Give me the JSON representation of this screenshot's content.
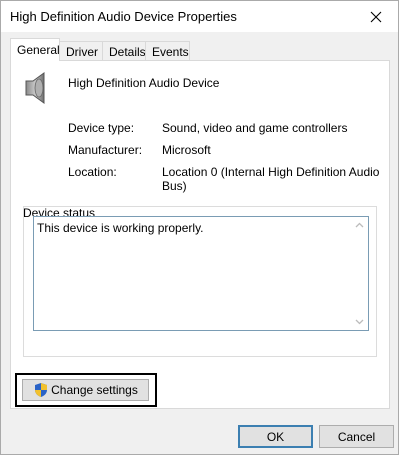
{
  "window": {
    "title": "High Definition Audio Device Properties"
  },
  "tabs": [
    {
      "label": "General",
      "active": true
    },
    {
      "label": "Driver",
      "active": false
    },
    {
      "label": "Details",
      "active": false
    },
    {
      "label": "Events",
      "active": false
    }
  ],
  "device": {
    "icon": "speaker-icon",
    "name": "High Definition Audio Device",
    "properties": [
      {
        "label": "Device type:",
        "value": "Sound, video and game controllers"
      },
      {
        "label": "Manufacturer:",
        "value": "Microsoft"
      },
      {
        "label": "Location:",
        "value": "Location 0 (Internal High Definition Audio Bus)"
      }
    ]
  },
  "status": {
    "legend": "Device status",
    "text": "This device is working properly."
  },
  "actions": {
    "change_settings_label": "Change settings",
    "change_settings_icon": "shield-icon"
  },
  "footer": {
    "ok_label": "OK",
    "cancel_label": "Cancel"
  },
  "colors": {
    "accent": "#3c7fb1",
    "shield_blue": "#2a63c7",
    "shield_yellow": "#f2c12e"
  }
}
